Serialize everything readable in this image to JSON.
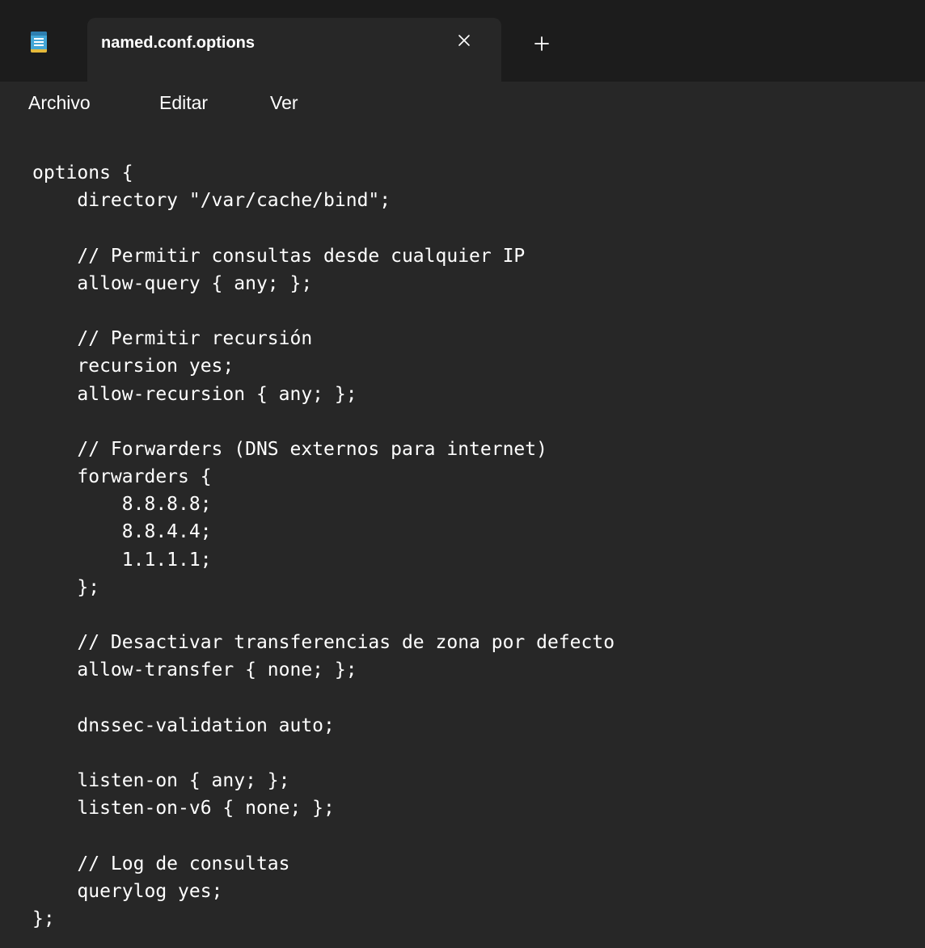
{
  "tab": {
    "title": "named.conf.options",
    "close_icon": "close-icon",
    "new_tab_icon": "plus-icon"
  },
  "menu": {
    "items": [
      "Archivo",
      "Editar",
      "Ver"
    ]
  },
  "editor": {
    "lines": [
      "options {",
      "    directory \"/var/cache/bind\";",
      "",
      "    // Permitir consultas desde cualquier IP",
      "    allow-query { any; };",
      "",
      "    // Permitir recursión",
      "    recursion yes;",
      "    allow-recursion { any; };",
      "",
      "    // Forwarders (DNS externos para internet)",
      "    forwarders {",
      "        8.8.8.8;",
      "        8.8.4.4;",
      "        1.1.1.1;",
      "    };",
      "",
      "    // Desactivar transferencias de zona por defecto",
      "    allow-transfer { none; };",
      "",
      "    dnssec-validation auto;",
      "",
      "    listen-on { any; };",
      "    listen-on-v6 { none; };",
      "",
      "    // Log de consultas",
      "    querylog yes;",
      "};"
    ]
  },
  "colors": {
    "titlebar": "#1c1c1c",
    "background": "#272727",
    "text": "#ffffff",
    "icon_accent": "#43a6d6",
    "icon_highlight": "#e5b93a"
  }
}
